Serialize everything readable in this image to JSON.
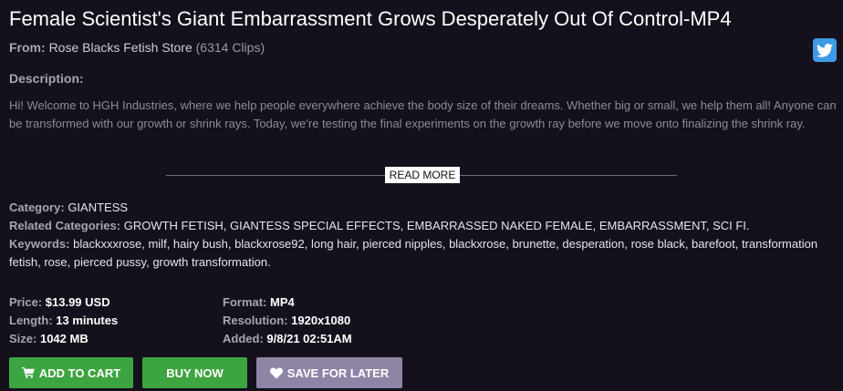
{
  "title": "Female Scientist's Giant Embarrassment Grows Desperately Out Of Control-MP4",
  "from": {
    "label": "From:",
    "store": "Rose Blacks Fetish Store",
    "clips": "(6314 Clips)"
  },
  "description": {
    "label": "Description:",
    "text": "Hi! Welcome to HGH Industries, where we help people everywhere achieve the body size of their dreams. Whether big or small, we help them all! Anyone can be transformed with our growth or shrink rays. Today, we're testing the final experiments on the growth ray before we move onto finalizing the shrink ray.",
    "read_more": "READ MORE"
  },
  "category": {
    "label": "Category:",
    "value": "GIANTESS"
  },
  "related": {
    "label": "Related Categories:",
    "items": [
      "GROWTH FETISH",
      "GIANTESS SPECIAL EFFECTS",
      "EMBARRASSED NAKED FEMALE",
      "EMBARRASSMENT",
      "SCI FI"
    ]
  },
  "keywords": {
    "label": "Keywords:",
    "items": [
      "blackxxxrose",
      "milf",
      "hairy bush",
      "blackxrose92",
      "long hair",
      "pierced nipples",
      "blackxrose",
      "brunette",
      "desperation",
      "rose black",
      "barefoot",
      "transformation fetish",
      "rose",
      "pierced pussy",
      "growth transformation"
    ]
  },
  "specs": {
    "price_label": "Price:",
    "price": "$13.99 USD",
    "length_label": "Length:",
    "length": "13 minutes",
    "size_label": "Size:",
    "size": "1042 MB",
    "format_label": "Format:",
    "format": "MP4",
    "resolution_label": "Resolution:",
    "resolution": "1920x1080",
    "added_label": "Added:",
    "added": "9/8/21 02:51AM"
  },
  "buttons": {
    "add_to_cart": "ADD TO CART",
    "buy_now": "BUY NOW",
    "save_for_later": "SAVE FOR LATER"
  },
  "colors": {
    "background": "#15111c",
    "green_button": "#3da442",
    "save_button": "#8f84a6",
    "twitter": "#3f9ae6"
  },
  "icons": [
    "twitter-icon",
    "cart-icon",
    "heart-icon"
  ]
}
